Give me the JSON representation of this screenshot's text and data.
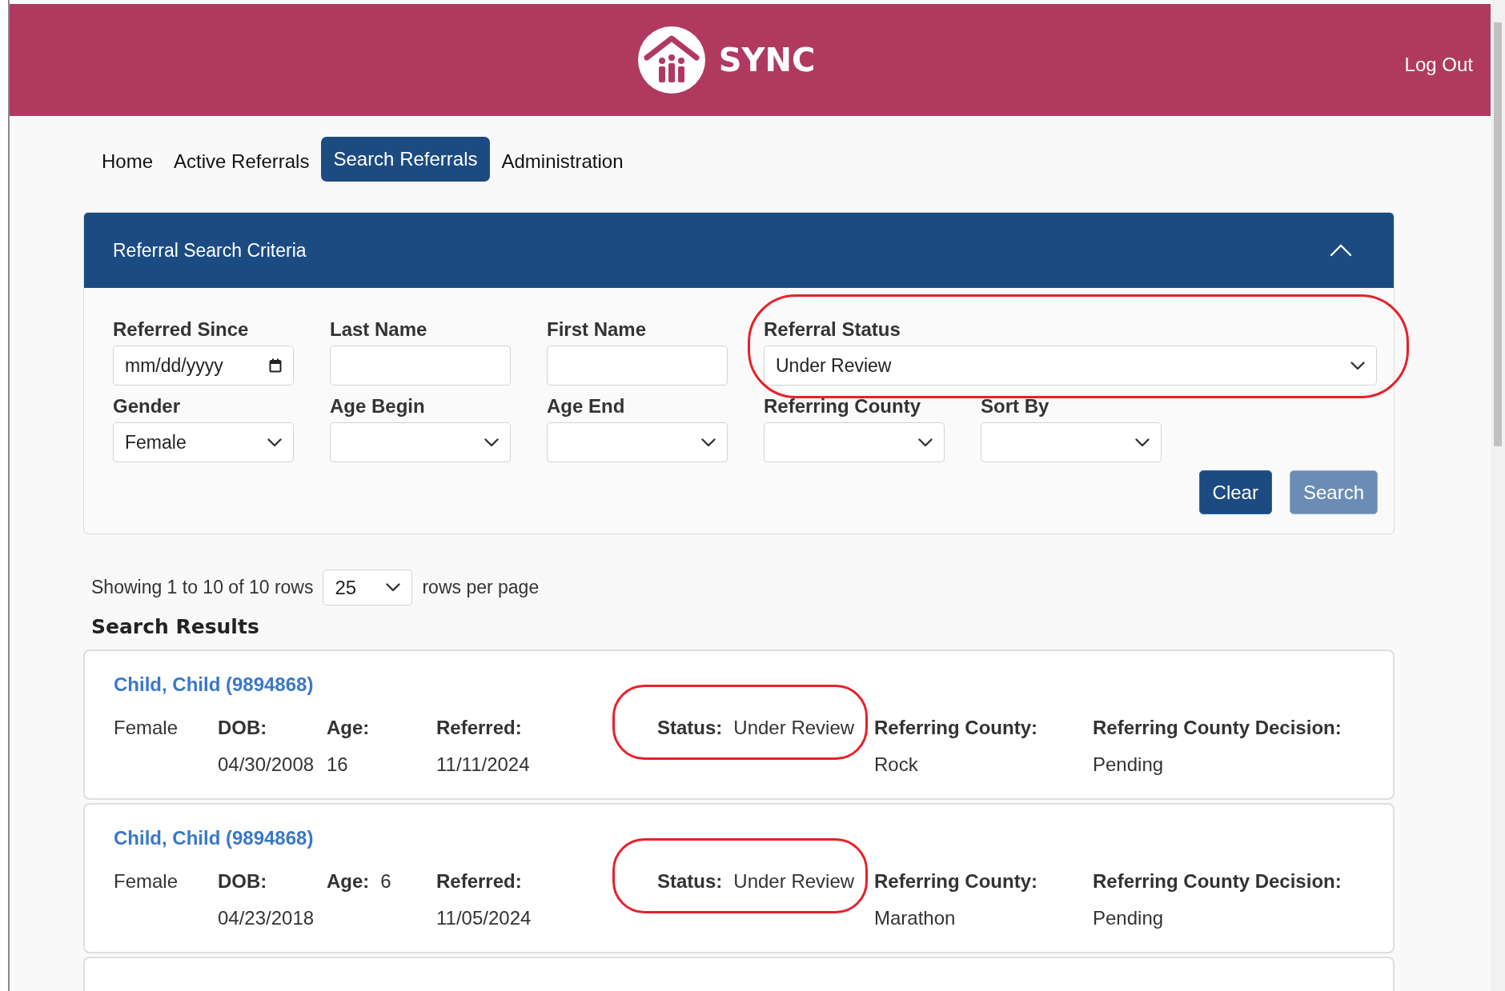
{
  "header": {
    "app_name": "SYNC",
    "logout": "Log Out"
  },
  "nav": [
    {
      "label": "Home",
      "selected": false
    },
    {
      "label": "Active Referrals",
      "selected": false
    },
    {
      "label": "Search Referrals",
      "selected": true
    },
    {
      "label": "Administration",
      "selected": false
    }
  ],
  "criteria_panel": {
    "title": "Referral Search Criteria",
    "expanded": true,
    "rows": [
      [
        {
          "kind": "date",
          "label": "Referred Since",
          "placeholder": "mm/dd/yyyy"
        },
        {
          "kind": "text",
          "label": "Last Name"
        },
        {
          "kind": "text",
          "label": "First Name"
        },
        {
          "kind": "select",
          "label": "Referral Status",
          "value": "Under Review",
          "annotated": true
        }
      ],
      [
        {
          "kind": "select",
          "label": "Gender",
          "value": "Female"
        },
        {
          "kind": "select",
          "label": "Age Begin"
        },
        {
          "kind": "select",
          "label": "Age End"
        },
        {
          "kind": "select",
          "label": "Referring County"
        },
        {
          "kind": "select",
          "label": "Sort By"
        }
      ]
    ],
    "buttons": [
      {
        "label": "Clear",
        "disabled": false
      },
      {
        "label": "Search",
        "disabled": true
      }
    ]
  },
  "pagination": {
    "showing": "Showing 1 to 10 of 10 rows",
    "page_size": "25",
    "suffix": "rows per page"
  },
  "results": {
    "title": "Search Results",
    "more_below": true,
    "cards": [
      {
        "name": "Child, Child (9894868)",
        "gender": "Female",
        "dob_label": "DOB:",
        "dob": "04/30/2008",
        "age_label": "Age:",
        "age": "16",
        "age_inline": false,
        "referred_label": "Referred:",
        "referred": "11/11/2024",
        "status_label": "Status:",
        "status": "Under Review",
        "status_annotated": true,
        "county_label": "Referring County:",
        "county": "Rock",
        "decision_label": "Referring County Decision:",
        "decision": "Pending"
      },
      {
        "name": "Child, Child (9894868)",
        "gender": "Female",
        "dob_label": "DOB:",
        "dob": "04/23/2018",
        "age_label": "Age:",
        "age": "6",
        "age_inline": true,
        "referred_label": "Referred:",
        "referred": "11/05/2024",
        "status_label": "Status:",
        "status": "Under Review",
        "status_annotated": true,
        "county_label": "Referring County:",
        "county": "Marathon",
        "decision_label": "Referring County Decision:",
        "decision": "Pending"
      }
    ]
  }
}
